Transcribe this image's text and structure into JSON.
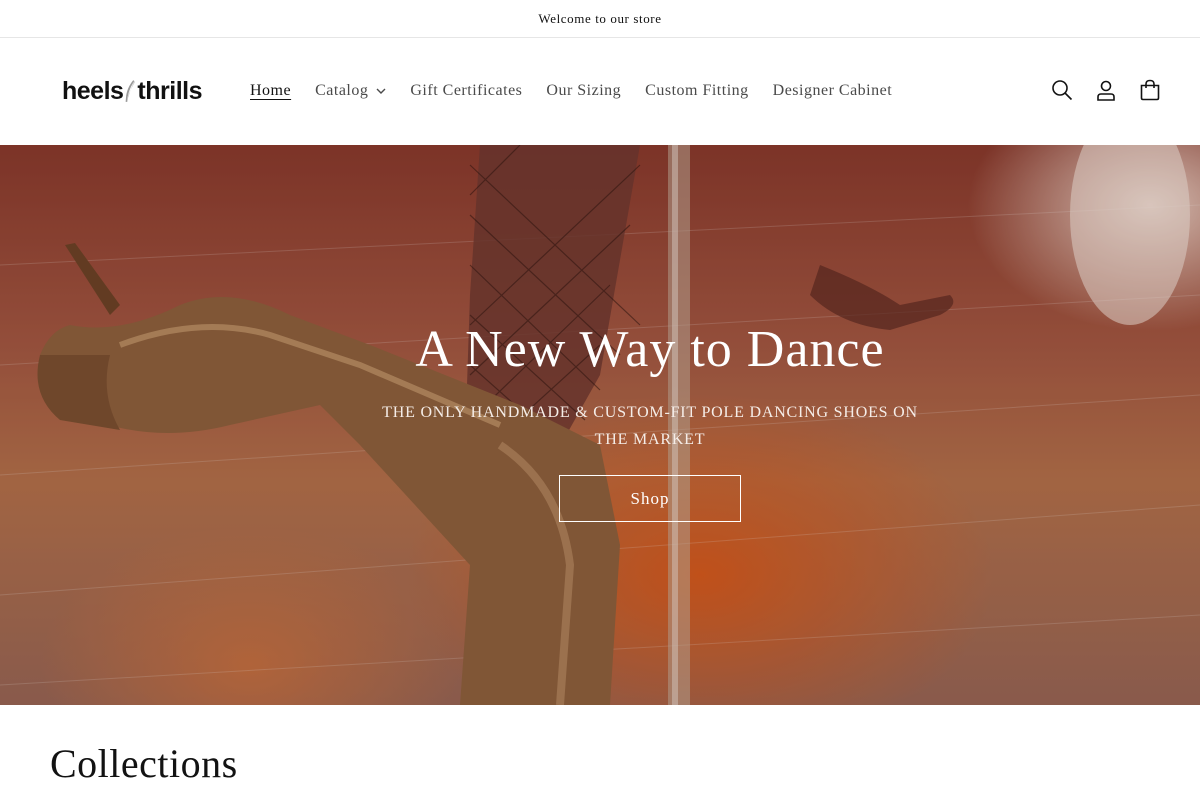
{
  "announcement": {
    "text": "Welcome to our store"
  },
  "logo": {
    "left_text": "heels",
    "right_text": "thrills"
  },
  "nav": {
    "items": [
      {
        "label": "Home",
        "active": true
      },
      {
        "label": "Catalog",
        "has_dropdown": true
      },
      {
        "label": "Gift Certificates"
      },
      {
        "label": "Our Sizing"
      },
      {
        "label": "Custom Fitting"
      },
      {
        "label": "Designer Cabinet"
      }
    ]
  },
  "header_icons": {
    "search": "search-icon",
    "account": "account-icon",
    "cart": "cart-icon"
  },
  "hero": {
    "title": "A New Way to Dance",
    "subtitle": "THE ONLY HANDMADE & CUSTOM-FIT POLE DANCING SHOES ON THE MARKET",
    "button_label": "Shop"
  },
  "collections": {
    "heading": "Collections"
  },
  "colors": {
    "text": "#121212",
    "muted_text": "#4a4a4a",
    "hero_text": "#ffffff",
    "border": "#e6e6e6"
  }
}
